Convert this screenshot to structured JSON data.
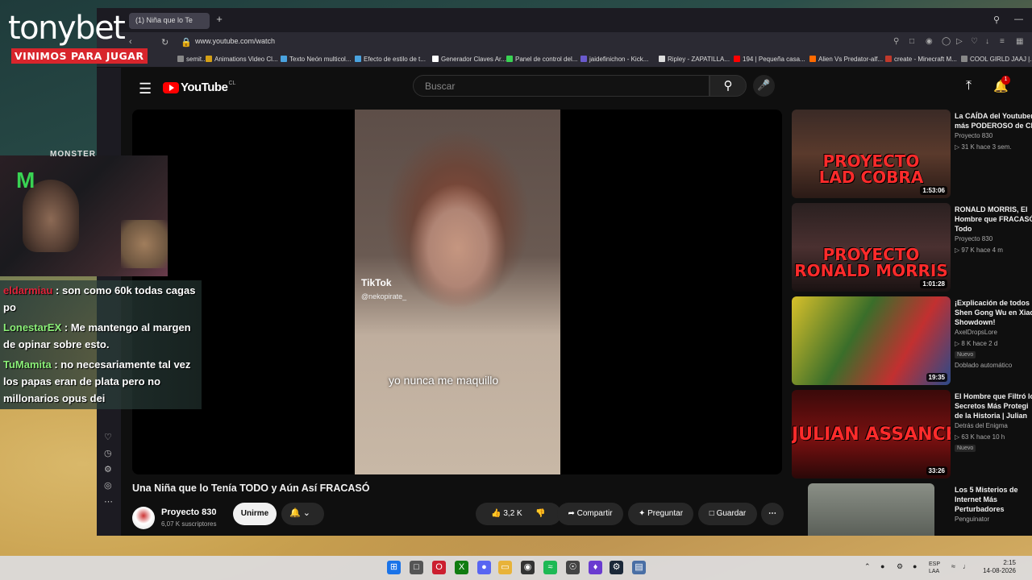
{
  "overlay": {
    "brand": "tonybet",
    "tagline": "VINIMOS PARA JUGAR",
    "sponsor": "MONSTER",
    "chat": [
      {
        "user": "eldarmiau",
        "message": ": son como 60k todas cagas po"
      },
      {
        "user": "LonestarEX",
        "message": ": Me mantengo al margen de opinar sobre esto."
      },
      {
        "user": "TuMamita",
        "message": ": no necesariamente tal vez los papas eran de plata pero no millonarios opus dei"
      }
    ]
  },
  "browser": {
    "tab_title": "(1) Niña que lo Te",
    "url": "www.youtube.com/watch",
    "bookmarks": [
      {
        "label": "semit...",
        "color": "#888888"
      },
      {
        "label": "Animations Video Cl...",
        "color": "#d4a017"
      },
      {
        "label": "Texto Neón multicol...",
        "color": "#4aa3df"
      },
      {
        "label": "Efecto de estilo de t...",
        "color": "#4aa3df"
      },
      {
        "label": "Generador Claves Ar...",
        "color": "#ffffff"
      },
      {
        "label": "Panel de control del...",
        "color": "#39d353"
      },
      {
        "label": "jaidefinichon - Kick...",
        "color": "#6a5acd"
      },
      {
        "label": "Ripley - ZAPATILLA...",
        "color": "#dddddd"
      },
      {
        "label": "194 | Pequeña casa...",
        "color": "#ff0000"
      },
      {
        "label": "Alien Vs Predator-alf...",
        "color": "#ff6a00"
      },
      {
        "label": "create - Minecraft M...",
        "color": "#c0392b"
      },
      {
        "label": "COOL GIRLD JAAJ |...",
        "color": "#888888"
      }
    ]
  },
  "youtube": {
    "logo": "YouTube",
    "country": "CL",
    "search_placeholder": "Buscar",
    "notifications": "1",
    "video": {
      "watermark": "TikTok",
      "tiktok_user": "@nekopirate_",
      "subtitle": "yo nunca me maquillo",
      "title": "Una Niña que lo Tenía TODO y Aún Así FRACASÓ",
      "channel": "Proyecto 830",
      "subscribers": "6,07 K suscriptores",
      "join_label": "Unirme",
      "likes": "3,2 K",
      "share_label": "Compartir",
      "ask_label": "Preguntar",
      "save_label": "Guardar"
    },
    "recommendations": [
      {
        "title": "La CAÍDA del Youtuber\nmás PODEROSO de Ch",
        "channel": "Proyecto 830",
        "meta": "31 K   hace 3 sem.",
        "duration": "1:53:06",
        "thumb_text": "PROYECTO\nLAD COBRA",
        "badge": "",
        "extra": ""
      },
      {
        "title": "RONALD MORRIS, El\nHombre que FRACASÓ\nTodo",
        "channel": "Proyecto 830",
        "meta": "97 K   hace 4 m",
        "duration": "1:01:28",
        "thumb_text": "PROYECTO\nRONALD MORRIS",
        "badge": "",
        "extra": ""
      },
      {
        "title": "¡Explicación de todos l\nShen Gong Wu en Xiao\nShowdown!",
        "channel": "AxelDropsLore",
        "meta": "8 K   hace 2 d",
        "duration": "19:35",
        "thumb_text": "",
        "badge": "Nuevo",
        "extra": "Doblado automático"
      },
      {
        "title": "El Hombre que Filtró lo\nSecretos Más Protegi\nde la Historia | Julian",
        "channel": "Detrás del Enigma",
        "meta": "63 K   hace 10 h",
        "duration": "33:26",
        "thumb_text": "JULIAN ASSANCE",
        "badge": "Nuevo",
        "extra": ""
      },
      {
        "title": "Los 5 Misterios de\nInternet Más\nPerturbadores",
        "channel": "Penguinator",
        "meta": "",
        "duration": "",
        "thumb_text": "",
        "badge": "",
        "extra": ""
      }
    ]
  },
  "taskbar": {
    "language": "ESP\nLAA",
    "time": "2:15",
    "date": "14-08-2026"
  }
}
